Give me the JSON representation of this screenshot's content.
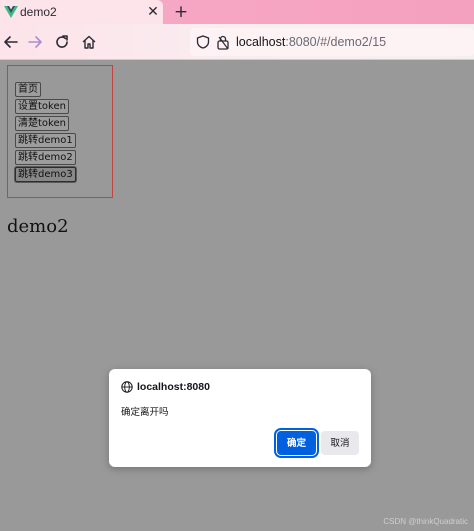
{
  "browser": {
    "tab": {
      "title": "demo2",
      "close_glyph": "✕"
    },
    "new_tab_glyph": "+",
    "nav": {
      "back_icon": "arrow-left-icon",
      "forward_icon": "arrow-right-icon",
      "reload_icon": "reload-icon",
      "home_icon": "home-icon"
    },
    "url": {
      "host": "localhost",
      "rest": ":8080/#/demo2/15"
    },
    "colors": {
      "tabbar": "#f4a0bf",
      "active_tab": "#fde3ea",
      "accent": "#0061e0"
    }
  },
  "page": {
    "buttons": [
      {
        "label": "首页"
      },
      {
        "label": "设置token"
      },
      {
        "label": "清楚token"
      },
      {
        "label": "跳转demo1"
      },
      {
        "label": "跳转demo2"
      },
      {
        "label": "跳转demo3"
      }
    ],
    "heading": "demo2"
  },
  "dialog": {
    "origin": "localhost:8080",
    "message": "确定离开吗",
    "ok_label": "确定",
    "cancel_label": "取消"
  },
  "watermark": "CSDN @thinkQuadratic"
}
